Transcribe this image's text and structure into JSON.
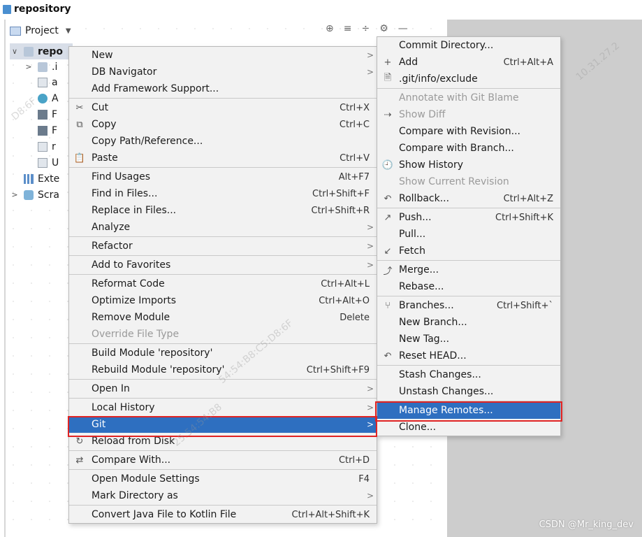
{
  "breadcrumb": "repository",
  "panel": {
    "title": "Project",
    "tools": [
      "⊕",
      "≡",
      "÷",
      "⚙",
      "—"
    ]
  },
  "tree": [
    {
      "label": "repo",
      "arrow": "∨",
      "icon": "folder-icon"
    },
    {
      "label": ".i",
      "arrow": ">",
      "icon": "folder-icon"
    },
    {
      "label": "a",
      "arrow": "",
      "icon": "file-icon"
    },
    {
      "label": "A",
      "arrow": "",
      "icon": "class-icon"
    },
    {
      "label": "F",
      "arrow": "",
      "icon": "markdown-icon"
    },
    {
      "label": "F",
      "arrow": "",
      "icon": "markdown-icon"
    },
    {
      "label": "r",
      "arrow": "",
      "icon": "file-icon"
    },
    {
      "label": "U",
      "arrow": "",
      "icon": "file-icon"
    },
    {
      "label": "Exte",
      "arrow": "",
      "icon": "external-libraries-icon"
    },
    {
      "label": "Scra",
      "arrow": ">",
      "icon": "scratches-icon"
    }
  ],
  "context_menu": {
    "items": [
      {
        "label": "New",
        "arrow": true
      },
      {
        "label": "DB Navigator",
        "arrow": true
      },
      {
        "label": "Add Framework Support..."
      },
      {
        "sep": true
      },
      {
        "label": "Cut",
        "shortcut": "Ctrl+X",
        "icon": "✂"
      },
      {
        "label": "Copy",
        "shortcut": "Ctrl+C",
        "icon": "⧉"
      },
      {
        "label": "Copy Path/Reference..."
      },
      {
        "label": "Paste",
        "shortcut": "Ctrl+V",
        "icon": "📋"
      },
      {
        "sep": true
      },
      {
        "label": "Find Usages",
        "shortcut": "Alt+F7"
      },
      {
        "label": "Find in Files...",
        "shortcut": "Ctrl+Shift+F"
      },
      {
        "label": "Replace in Files...",
        "shortcut": "Ctrl+Shift+R"
      },
      {
        "label": "Analyze",
        "arrow": true
      },
      {
        "sep": true
      },
      {
        "label": "Refactor",
        "arrow": true
      },
      {
        "sep": true
      },
      {
        "label": "Add to Favorites",
        "arrow": true
      },
      {
        "sep": true
      },
      {
        "label": "Reformat Code",
        "shortcut": "Ctrl+Alt+L"
      },
      {
        "label": "Optimize Imports",
        "shortcut": "Ctrl+Alt+O"
      },
      {
        "label": "Remove Module",
        "shortcut": "Delete"
      },
      {
        "label": "Override File Type",
        "disabled": true
      },
      {
        "sep": true
      },
      {
        "label": "Build Module 'repository'"
      },
      {
        "label": "Rebuild Module 'repository'",
        "shortcut": "Ctrl+Shift+F9"
      },
      {
        "sep": true
      },
      {
        "label": "Open In",
        "arrow": true
      },
      {
        "sep": true
      },
      {
        "label": "Local History",
        "arrow": true
      },
      {
        "label": "Git",
        "arrow": true,
        "highlighted": true
      },
      {
        "label": "Reload from Disk",
        "icon": "↻"
      },
      {
        "sep": true
      },
      {
        "label": "Compare With...",
        "shortcut": "Ctrl+D",
        "icon": "⇄"
      },
      {
        "sep": true
      },
      {
        "label": "Open Module Settings",
        "shortcut": "F4"
      },
      {
        "label": "Mark Directory as",
        "arrow": true
      },
      {
        "sep": true
      },
      {
        "label": "Convert Java File to Kotlin File",
        "shortcut": "Ctrl+Alt+Shift+K"
      }
    ]
  },
  "git_menu": {
    "items": [
      {
        "label": "Commit Directory..."
      },
      {
        "label": "Add",
        "shortcut": "Ctrl+Alt+A",
        "icon": "+"
      },
      {
        "label": ".git/info/exclude",
        "icon": "🗎"
      },
      {
        "sep": true
      },
      {
        "label": "Annotate with Git Blame",
        "disabled": true
      },
      {
        "label": "Show Diff",
        "disabled": true,
        "icon": "⇢"
      },
      {
        "label": "Compare with Revision..."
      },
      {
        "label": "Compare with Branch..."
      },
      {
        "label": "Show History",
        "icon": "🕘"
      },
      {
        "label": "Show Current Revision",
        "disabled": true
      },
      {
        "label": "Rollback...",
        "shortcut": "Ctrl+Alt+Z",
        "icon": "↶"
      },
      {
        "sep": true
      },
      {
        "label": "Push...",
        "shortcut": "Ctrl+Shift+K",
        "icon": "↗"
      },
      {
        "label": "Pull..."
      },
      {
        "label": "Fetch",
        "icon": "↙"
      },
      {
        "sep": true
      },
      {
        "label": "Merge...",
        "icon": "⤴"
      },
      {
        "label": "Rebase..."
      },
      {
        "sep": true
      },
      {
        "label": "Branches...",
        "shortcut": "Ctrl+Shift+`",
        "icon": "⑂"
      },
      {
        "label": "New Branch..."
      },
      {
        "label": "New Tag..."
      },
      {
        "label": "Reset HEAD...",
        "icon": "↶"
      },
      {
        "sep": true
      },
      {
        "label": "Stash Changes..."
      },
      {
        "label": "Unstash Changes..."
      },
      {
        "sep": true
      },
      {
        "label": "Manage Remotes...",
        "highlighted": true
      },
      {
        "label": "Clone..."
      }
    ]
  },
  "watermarks": [
    "D8:6F",
    "10.31.27.2",
    "54:54:B8:C5:D8:6F",
    "25.54:54:B8"
  ],
  "credit": "CSDN @Mr_king_dev",
  "colors": {
    "highlight": "#2e6fc0",
    "annotation": "#e02424"
  }
}
